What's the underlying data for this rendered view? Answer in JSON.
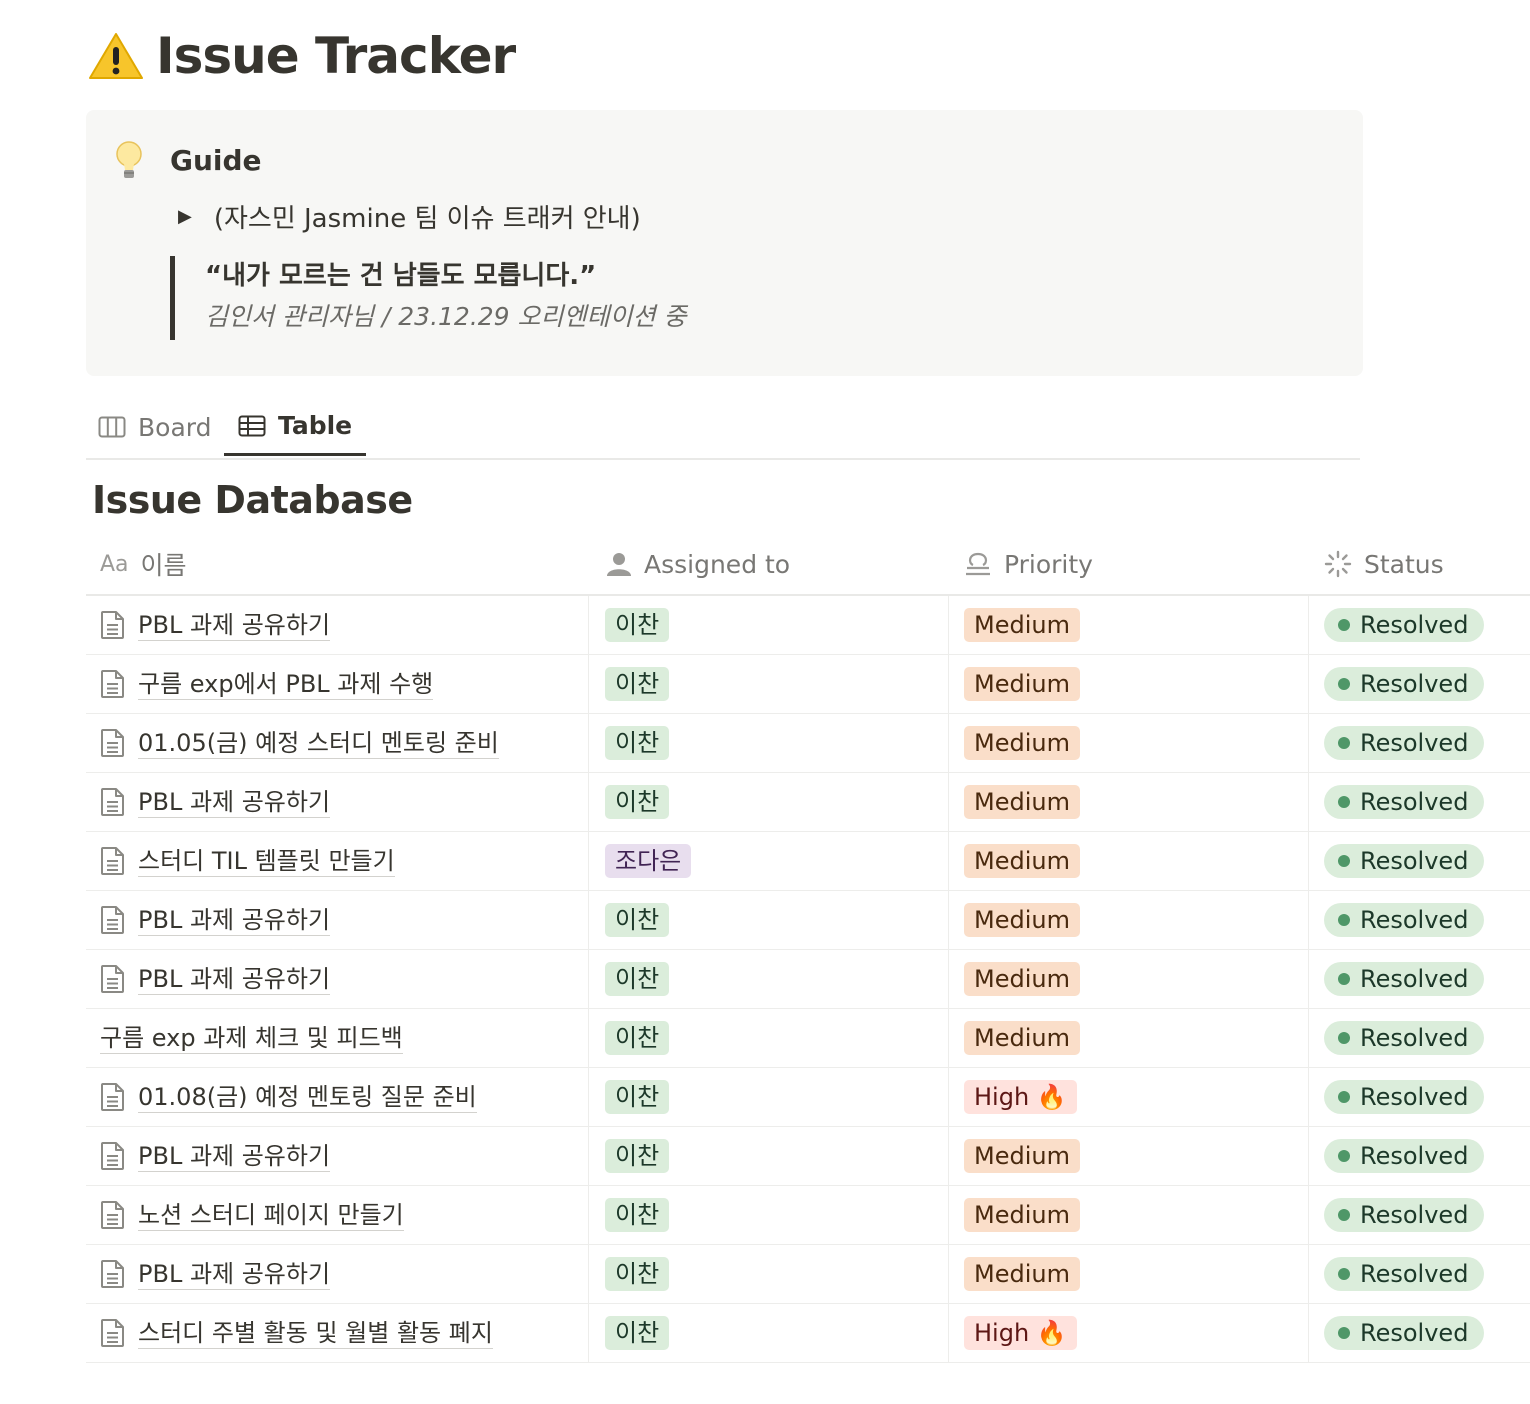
{
  "page": {
    "title": "Issue Tracker",
    "title_icon": "warning-icon"
  },
  "callout": {
    "icon": "lightbulb-icon",
    "title": "Guide",
    "toggle_label": "(자스민 Jasmine 팀 이슈 트래커 안내)",
    "quote_text": "“내가 모르는 건 남들도 모릅니다.”",
    "quote_cite": "김인서 관리자님 / 23.12.29 오리엔테이션 중"
  },
  "views": {
    "tabs": [
      {
        "label": "Board",
        "icon": "board-icon",
        "active": false
      },
      {
        "label": "Table",
        "icon": "table-icon",
        "active": true
      }
    ]
  },
  "database": {
    "title": "Issue Database",
    "columns": {
      "name": {
        "prefix": "Aa",
        "label": "이름"
      },
      "assigned": {
        "label": "Assigned to",
        "icon": "person-icon"
      },
      "priority": {
        "label": "Priority",
        "icon": "priority-icon"
      },
      "status": {
        "label": "Status",
        "icon": "status-icon"
      }
    },
    "rows": [
      {
        "name": "PBL 과제 공유하기",
        "has_icon": true,
        "assigned": "이찬",
        "priority": "Medium",
        "status": "Resolved"
      },
      {
        "name": "구름 exp에서 PBL 과제 수행",
        "has_icon": true,
        "assigned": "이찬",
        "priority": "Medium",
        "status": "Resolved"
      },
      {
        "name": "01.05(금) 예정 스터디 멘토링 준비",
        "has_icon": true,
        "assigned": "이찬",
        "priority": "Medium",
        "status": "Resolved"
      },
      {
        "name": "PBL 과제 공유하기",
        "has_icon": true,
        "assigned": "이찬",
        "priority": "Medium",
        "status": "Resolved"
      },
      {
        "name": "스터디 TIL 템플릿 만들기",
        "has_icon": true,
        "assigned": "조다은",
        "priority": "Medium",
        "status": "Resolved"
      },
      {
        "name": "PBL 과제 공유하기",
        "has_icon": true,
        "assigned": "이찬",
        "priority": "Medium",
        "status": "Resolved"
      },
      {
        "name": "PBL 과제 공유하기",
        "has_icon": true,
        "assigned": "이찬",
        "priority": "Medium",
        "status": "Resolved"
      },
      {
        "name": "구름 exp 과제 체크 및 피드백",
        "has_icon": false,
        "assigned": "이찬",
        "priority": "Medium",
        "status": "Resolved"
      },
      {
        "name": "01.08(금) 예정 멘토링 질문 준비",
        "has_icon": true,
        "assigned": "이찬",
        "priority": "High 🔥",
        "status": "Resolved"
      },
      {
        "name": "PBL 과제 공유하기",
        "has_icon": true,
        "assigned": "이찬",
        "priority": "Medium",
        "status": "Resolved"
      },
      {
        "name": "노션 스터디 페이지 만들기",
        "has_icon": true,
        "assigned": "이찬",
        "priority": "Medium",
        "status": "Resolved"
      },
      {
        "name": "PBL 과제 공유하기",
        "has_icon": true,
        "assigned": "이찬",
        "priority": "Medium",
        "status": "Resolved"
      },
      {
        "name": "스터디 주별 활동 및 월별 활동 폐지",
        "has_icon": true,
        "assigned": "이찬",
        "priority": "High 🔥",
        "status": "Resolved"
      }
    ]
  },
  "colors": {
    "assignee": {
      "이찬": {
        "bg": "#dbeddb",
        "fg": "#1c3829"
      },
      "조다은": {
        "bg": "#e8deee",
        "fg": "#412454"
      }
    },
    "priority": {
      "Medium": {
        "bg": "#fadec9",
        "fg": "#49290e"
      },
      "High 🔥": {
        "bg": "#ffe2dd",
        "fg": "#5d1715"
      }
    },
    "status": {
      "Resolved": {
        "bg": "#dbeddb",
        "fg": "#1c3829",
        "dot": "#4f9768"
      }
    }
  }
}
